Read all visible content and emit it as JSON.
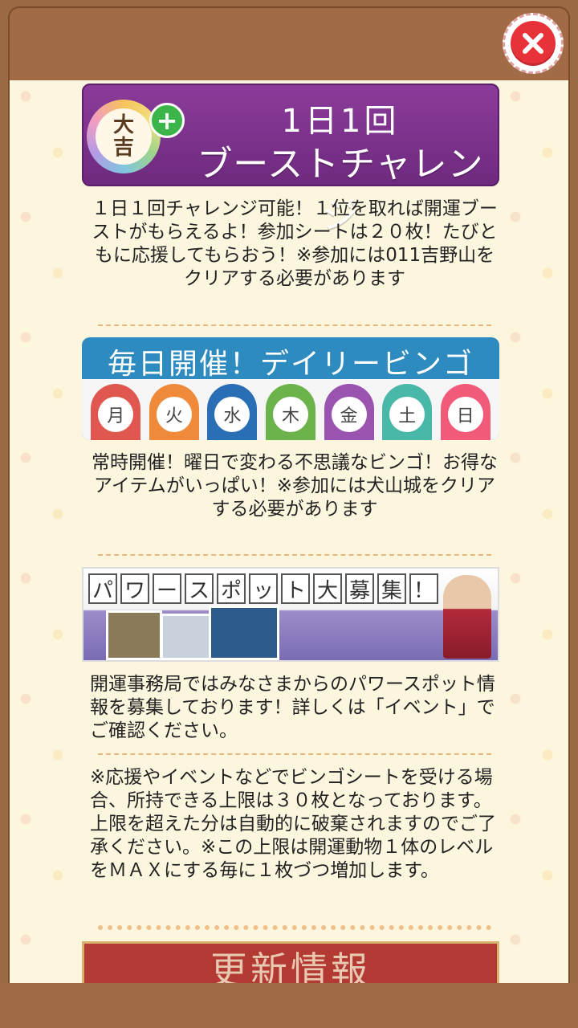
{
  "close_button": {
    "icon": "close-icon",
    "color": "#e8323a"
  },
  "banner_boost": {
    "badge_text_top": "大",
    "badge_text_bottom": "吉",
    "plus": "+",
    "line1": "1日1回",
    "line2": "ブーストチャレンジ"
  },
  "boost_text": "１日１回チャレンジ可能！１位を取れば開運ブーストがもらえるよ！参加シートは２０枚！たびともに応援してもらおう！※参加には011吉野山をクリアする必要があります",
  "banner_bingo": {
    "title": "毎日開催！デイリービンゴ",
    "days": [
      {
        "label": "月",
        "color": "#e0574f"
      },
      {
        "label": "火",
        "color": "#ef8a3a"
      },
      {
        "label": "水",
        "color": "#2a6fb6"
      },
      {
        "label": "木",
        "color": "#6bb34a"
      },
      {
        "label": "金",
        "color": "#9a54b0"
      },
      {
        "label": "土",
        "color": "#4ab8a8"
      },
      {
        "label": "日",
        "color": "#f25a7a"
      }
    ]
  },
  "bingo_text": "常時開催！曜日で変わる不思議なビンゴ！お得なアイテムがいっぱい！※参加には犬山城をクリアする必要があります",
  "banner_powerspot": {
    "title_chars": [
      "パ",
      "ワ",
      "ー",
      "ス",
      "ポ",
      "ッ",
      "ト",
      "大",
      "募",
      "集",
      "！"
    ]
  },
  "powerspot_text": "開運事務局ではみなさまからのパワースポット情報を募集しております！詳しくは「イベント」でご確認ください。",
  "notice_text": "※応援やイベントなどでビンゴシートを受ける場合、所持できる上限は３０枚となっております。上限を超えた分は自動的に破棄されますのでご了承ください。※この上限は開運動物１体のレベルをＭＡＸにする毎に１枚づつ増加します。",
  "update_header": "更新情報"
}
